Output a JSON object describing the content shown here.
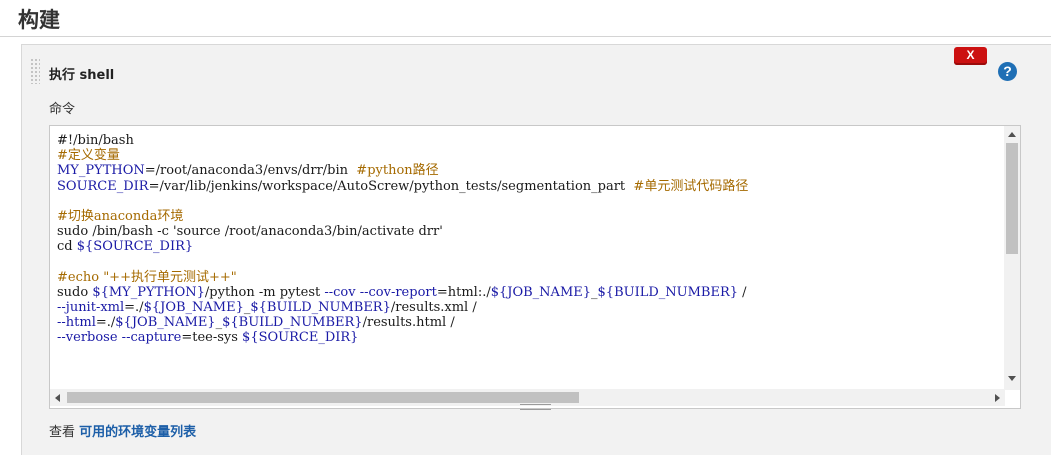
{
  "section": {
    "title": "构建"
  },
  "step": {
    "title": "执行 shell",
    "delete_label": "X",
    "help_label": "?"
  },
  "command": {
    "label": "命令",
    "lines": [
      [
        {
          "t": "#!/bin/bash",
          "c": ""
        }
      ],
      [
        {
          "t": "#定义变量",
          "c": "c-comment"
        }
      ],
      [
        {
          "t": "MY_PYTHON",
          "c": "c-var"
        },
        {
          "t": "=/root/anaconda3/envs/drr/bin  ",
          "c": ""
        },
        {
          "t": "#python路径",
          "c": "c-comment"
        }
      ],
      [
        {
          "t": "SOURCE_DIR",
          "c": "c-var"
        },
        {
          "t": "=/var/lib/jenkins/workspace/AutoScrew/python_tests/segmentation_part  ",
          "c": ""
        },
        {
          "t": "#单元测试代码路径",
          "c": "c-comment"
        }
      ],
      [
        {
          "t": "",
          "c": ""
        }
      ],
      [
        {
          "t": "#切换anaconda环境",
          "c": "c-comment"
        }
      ],
      [
        {
          "t": "sudo /bin/bash -c 'source /root/anaconda3/bin/activate drr'",
          "c": ""
        }
      ],
      [
        {
          "t": "cd ",
          "c": ""
        },
        {
          "t": "${SOURCE_DIR}",
          "c": "c-var"
        }
      ],
      [
        {
          "t": "",
          "c": ""
        }
      ],
      [
        {
          "t": "#echo \"++执行单元测试++\"",
          "c": "c-comment"
        }
      ],
      [
        {
          "t": "sudo ",
          "c": ""
        },
        {
          "t": "${MY_PYTHON}",
          "c": "c-var"
        },
        {
          "t": "/python -m pytest ",
          "c": ""
        },
        {
          "t": "--cov --cov-report",
          "c": "c-kw"
        },
        {
          "t": "=html:./",
          "c": ""
        },
        {
          "t": "${JOB_NAME}",
          "c": "c-var"
        },
        {
          "t": "_",
          "c": ""
        },
        {
          "t": "${BUILD_NUMBER}",
          "c": "c-var"
        },
        {
          "t": " /",
          "c": ""
        }
      ],
      [
        {
          "t": "--junit-xml",
          "c": "c-kw"
        },
        {
          "t": "=./",
          "c": ""
        },
        {
          "t": "${JOB_NAME}",
          "c": "c-var"
        },
        {
          "t": "_",
          "c": ""
        },
        {
          "t": "${BUILD_NUMBER}",
          "c": "c-var"
        },
        {
          "t": "/results.xml /",
          "c": ""
        }
      ],
      [
        {
          "t": "--html",
          "c": "c-kw"
        },
        {
          "t": "=./",
          "c": ""
        },
        {
          "t": "${JOB_NAME}",
          "c": "c-var"
        },
        {
          "t": "_",
          "c": ""
        },
        {
          "t": "${BUILD_NUMBER}",
          "c": "c-var"
        },
        {
          "t": "/results.html /",
          "c": ""
        }
      ],
      [
        {
          "t": "--verbose --capture",
          "c": "c-kw"
        },
        {
          "t": "=tee-sys ",
          "c": ""
        },
        {
          "t": "${SOURCE_DIR}",
          "c": "c-var"
        }
      ]
    ]
  },
  "footer": {
    "prefix": "查看 ",
    "link_text": "可用的环境变量列表"
  },
  "colors": {
    "comment": "#a56a00",
    "variable": "#1a1aa6",
    "delete_button": "#cc1111",
    "help_icon": "#1f6fb5",
    "link": "#1d5fa8"
  },
  "icons": {
    "delete": "close-x-icon",
    "help": "question-circle-icon",
    "drag": "drag-handle-icon"
  }
}
